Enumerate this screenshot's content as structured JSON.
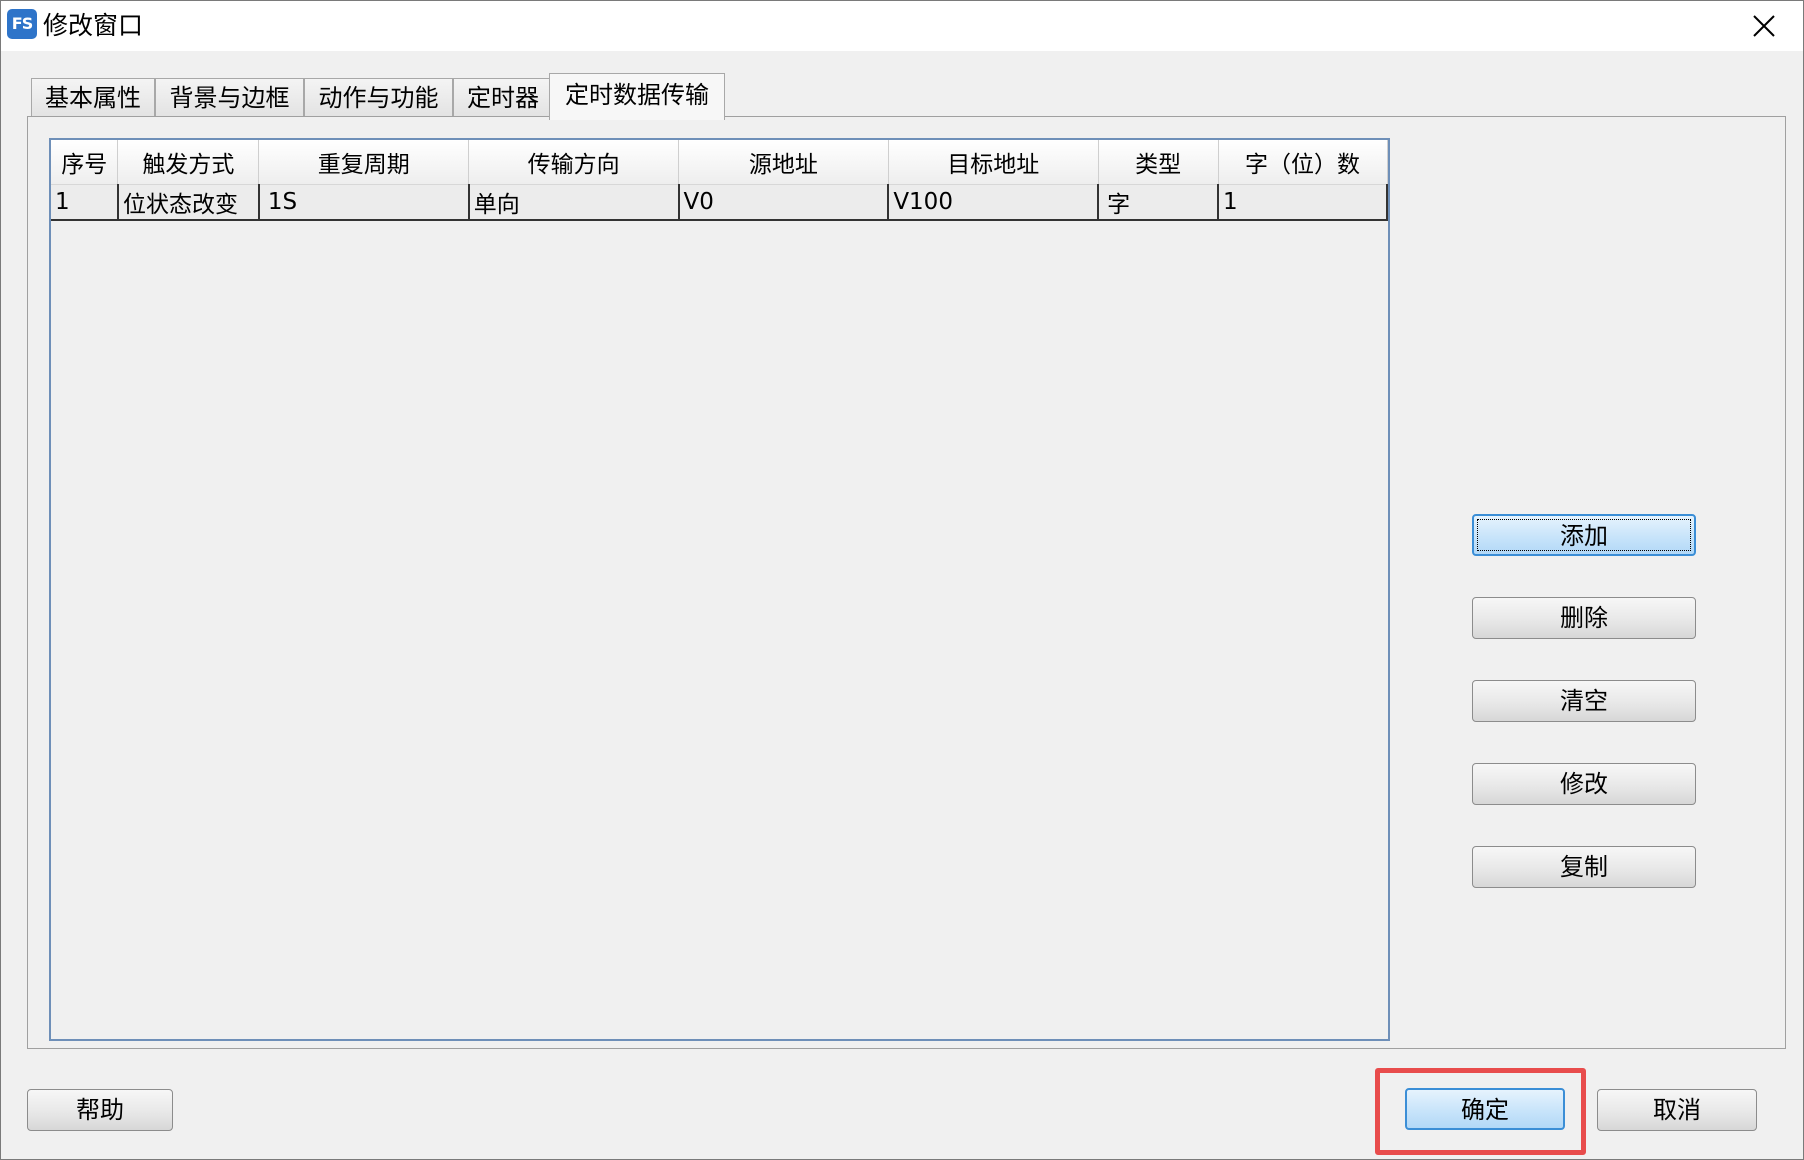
{
  "window": {
    "title": "修改窗口",
    "app_icon_text": "FS",
    "close_icon": "close-icon"
  },
  "tabs": [
    {
      "label": "基本属性",
      "active": false
    },
    {
      "label": "背景与边框",
      "active": false
    },
    {
      "label": "动作与功能",
      "active": false
    },
    {
      "label": "定时器",
      "active": false
    },
    {
      "label": "定时数据传输",
      "active": true
    }
  ],
  "table": {
    "columns": [
      "序号",
      "触发方式",
      "重复周期",
      "传输方向",
      "源地址",
      "目标地址",
      "类型",
      "字（位）数"
    ],
    "rows": [
      [
        "1",
        "位状态改变",
        "1S",
        "单向",
        "V0",
        "V100",
        "字",
        "1"
      ]
    ]
  },
  "side_buttons": {
    "add": "添加",
    "delete": "删除",
    "clear": "清空",
    "modify": "修改",
    "copy": "复制"
  },
  "bottom_buttons": {
    "help": "帮助",
    "ok": "确定",
    "cancel": "取消"
  },
  "colors": {
    "highlight": "#e84c4c",
    "accent": "#3b8ed6"
  }
}
